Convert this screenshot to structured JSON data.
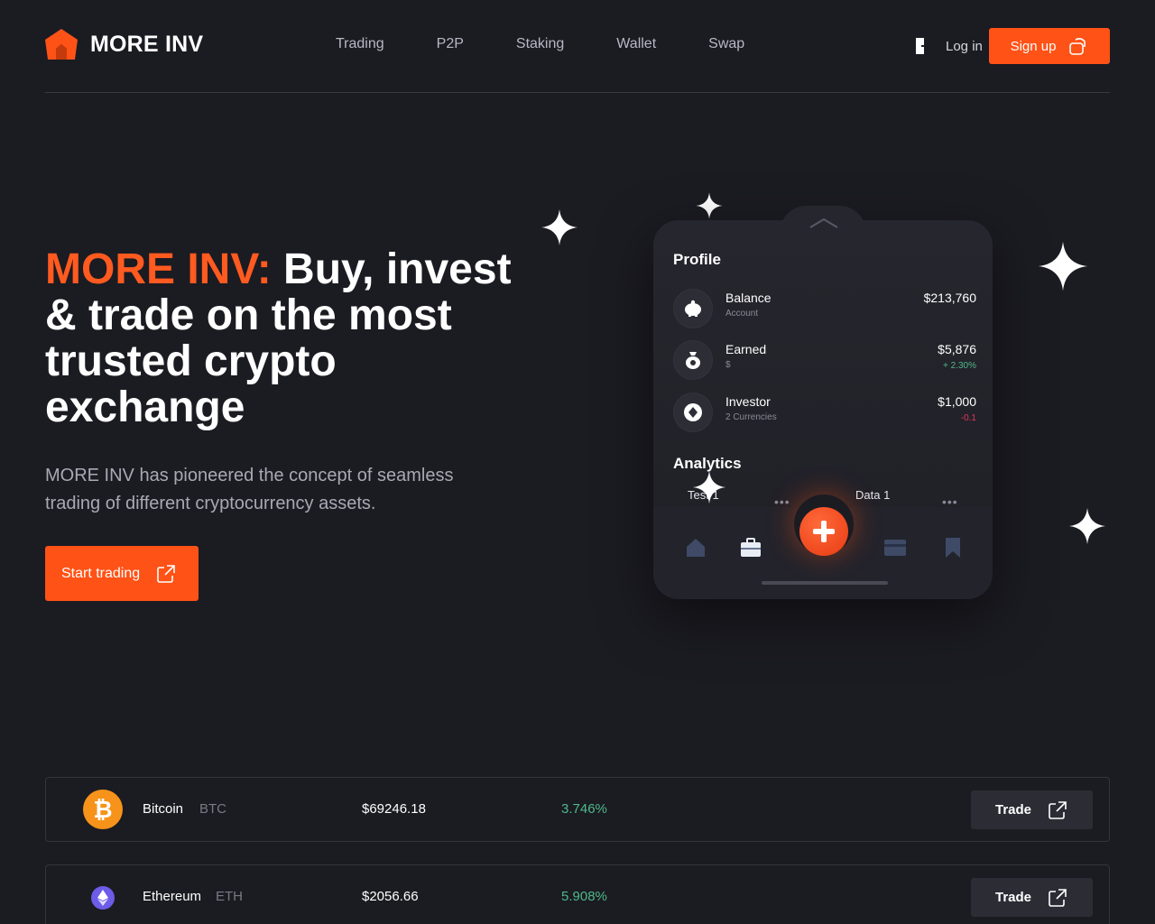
{
  "brand": {
    "name": "MORE INV",
    "accent_color": "#ff5216"
  },
  "nav": {
    "items": [
      "Trading",
      "P2P",
      "Staking",
      "Wallet",
      "Swap"
    ]
  },
  "auth": {
    "login_label": "Log in",
    "signup_label": "Sign up"
  },
  "hero": {
    "title_accent": "MORE INV:",
    "title_rest": "Buy, invest & trade on the most trusted crypto exchange",
    "description": "MORE INV has pioneered the concept of seamless trading of different cryptocurrency assets.",
    "cta_label": "Start trading"
  },
  "phone": {
    "profile_title": "Profile",
    "rows": [
      {
        "icon": "piggy-bank-icon",
        "name": "Balance",
        "sub": "Account",
        "value": "$213,760",
        "change": ""
      },
      {
        "icon": "money-bag-icon",
        "name": "Earned",
        "sub": "$",
        "value": "$5,876",
        "change": "+ 2.30%"
      },
      {
        "icon": "investor-icon",
        "name": "Investor",
        "sub": "2 Currencies",
        "value": "$1,000",
        "change": "-0.1"
      }
    ],
    "analytics_title": "Analytics",
    "chips": [
      "Test 1",
      "Data 1"
    ],
    "tabs": [
      "home-icon",
      "briefcase-icon",
      "plus-icon",
      "card-icon",
      "bookmark-icon"
    ]
  },
  "market": [
    {
      "name": "Bitcoin",
      "symbol": "BTC",
      "price": "$69246.18",
      "change": "3.746%",
      "trade_label": "Trade",
      "coin_color": "#f7931a"
    },
    {
      "name": "Ethereum",
      "symbol": "ETH",
      "price": "$2056.66",
      "change": "5.908%",
      "trade_label": "Trade",
      "coin_color": "#6c5ce7"
    }
  ]
}
